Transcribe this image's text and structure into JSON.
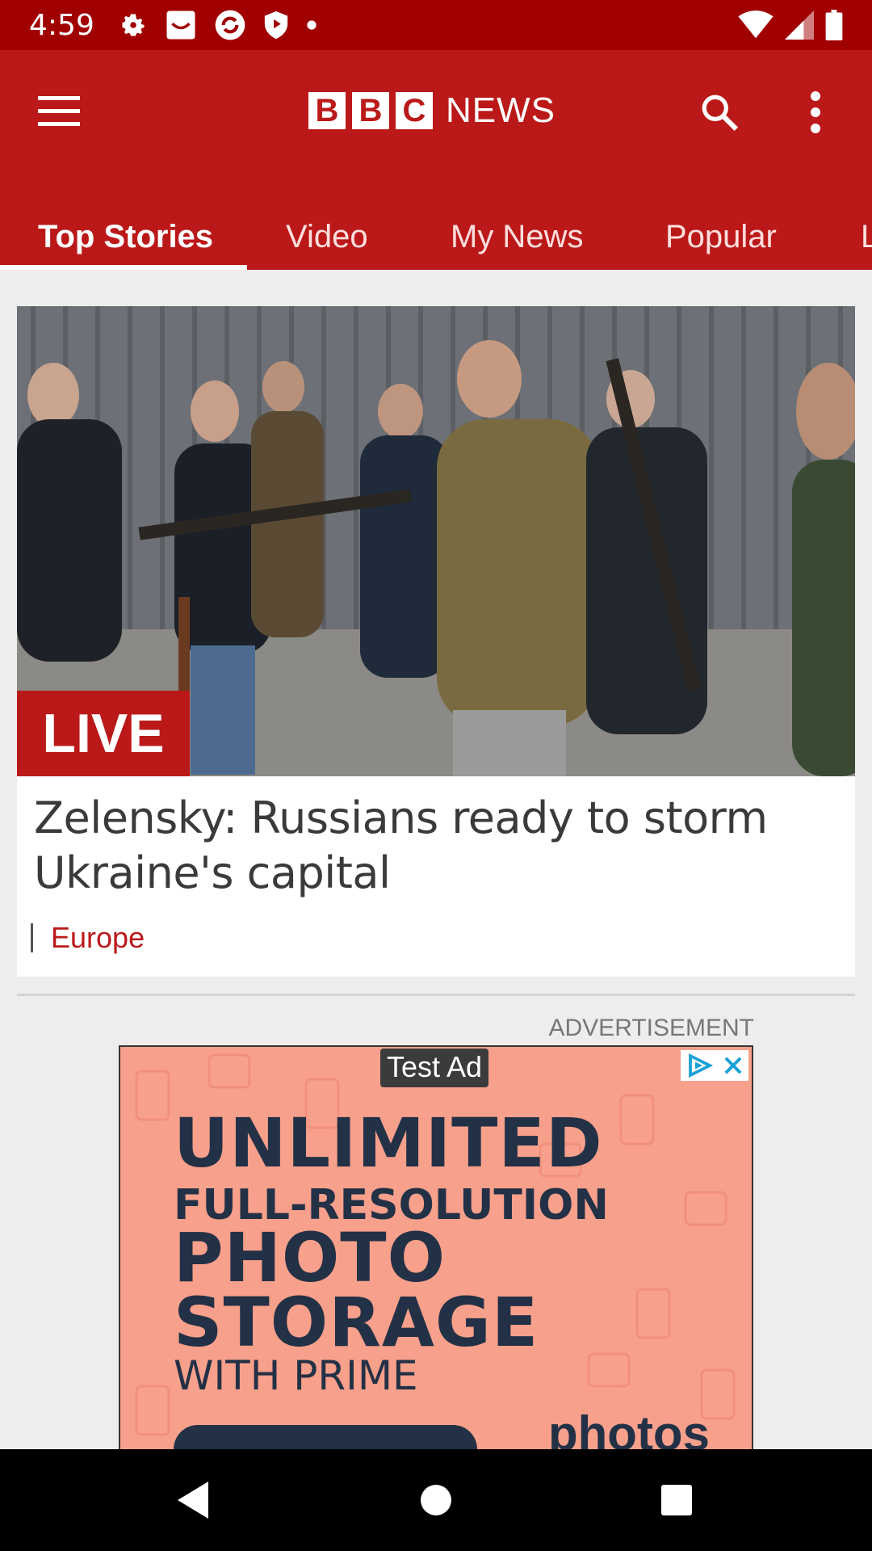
{
  "status_bar": {
    "time": "4:59",
    "icons": [
      "gear-icon",
      "mail-icon",
      "sync-icon",
      "shield-icon",
      "dot-icon"
    ],
    "right_icons": [
      "wifi-icon",
      "signal-icon",
      "battery-icon"
    ]
  },
  "app_bar": {
    "logo_letters": [
      "B",
      "B",
      "C"
    ],
    "logo_news": "NEWS",
    "background": "#bb1919"
  },
  "tabs": [
    {
      "label": "Top Stories",
      "active": true
    },
    {
      "label": "Video",
      "active": false
    },
    {
      "label": "My News",
      "active": false
    },
    {
      "label": "Popular",
      "active": false
    },
    {
      "label": "L",
      "active": false
    }
  ],
  "story": {
    "badge": "LIVE",
    "headline": "Zelensky: Russians ready to storm Ukraine's capital",
    "section": "Europe"
  },
  "advertisement": {
    "label": "ADVERTISEMENT",
    "test_label": "Test Ad",
    "lines": [
      "UNLIMITED",
      "FULL-RESOLUTION",
      "PHOTO",
      "STORAGE",
      "WITH PRIME"
    ],
    "brand": "photos"
  },
  "nav_bar": {
    "buttons": [
      "back-icon",
      "home-icon",
      "recents-icon"
    ]
  }
}
